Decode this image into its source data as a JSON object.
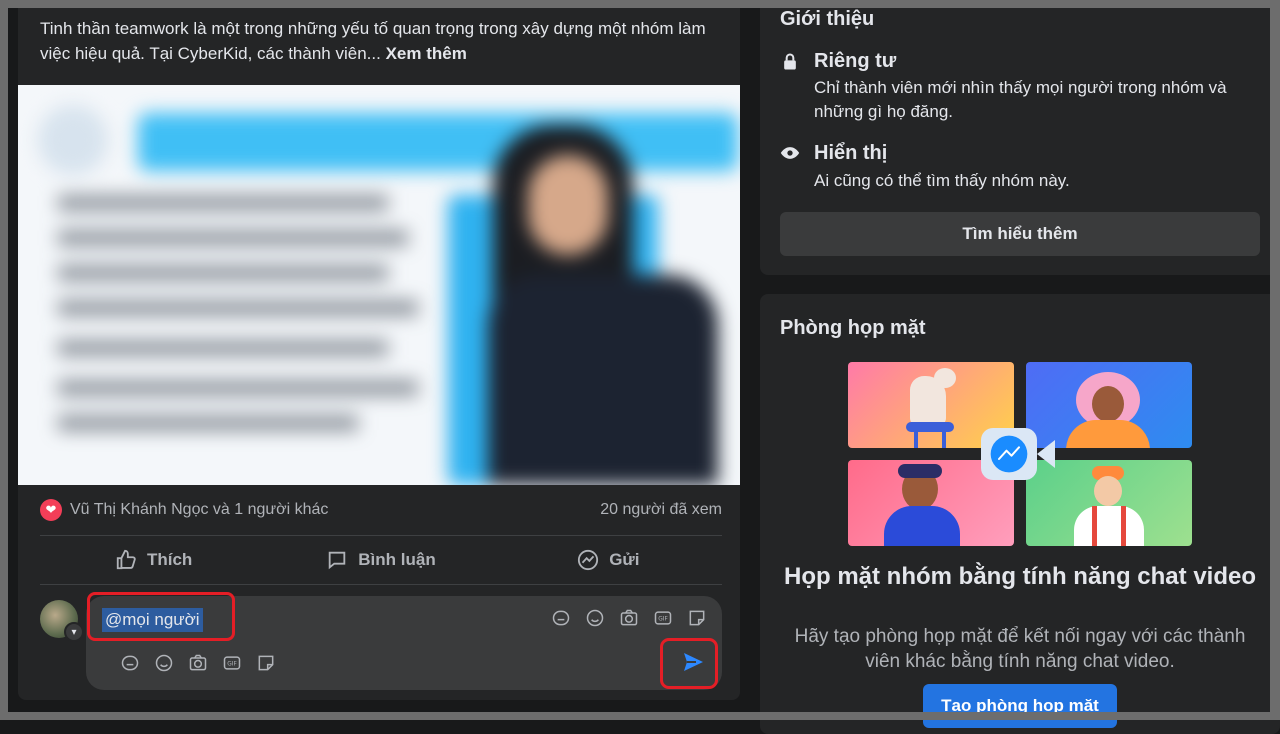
{
  "post": {
    "text": "Tinh thần teamwork là một trong những yếu tố quan trọng trong xây dựng một nhóm làm việc hiệu quả. Tại CyberKid, các thành viên...",
    "see_more": "Xem thêm",
    "reactions": "Vũ Thị Khánh Ngọc và 1 người khác",
    "views": "20 người đã xem",
    "actions": {
      "like": "Thích",
      "comment": "Bình luận",
      "share": "Gửi"
    },
    "comment_input": "@mọi người",
    "icons": [
      "sticker-icon",
      "emoji-icon",
      "camera-icon",
      "gif-icon",
      "sticker-alt-icon",
      "send-icon"
    ],
    "highlight_color": "#e41e26"
  },
  "about": {
    "title": "Giới thiệu",
    "private_title": "Riêng tư",
    "private_desc": "Chỉ thành viên mới nhìn thấy mọi người trong nhóm và những gì họ đăng.",
    "visible_title": "Hiển thị",
    "visible_desc": "Ai cũng có thể tìm thấy nhóm này.",
    "learn_more": "Tìm hiểu thêm"
  },
  "meet": {
    "title": "Phòng họp mặt",
    "heading": "Họp mặt nhóm bằng tính năng chat video",
    "desc": "Hãy tạo phòng họp mặt để kết nối ngay với các thành viên khác bằng tính năng chat video.",
    "create": "Tạo phòng họp mặt"
  },
  "colors": {
    "accent": "#2374e1",
    "background": "#18191a",
    "card": "#242526"
  }
}
